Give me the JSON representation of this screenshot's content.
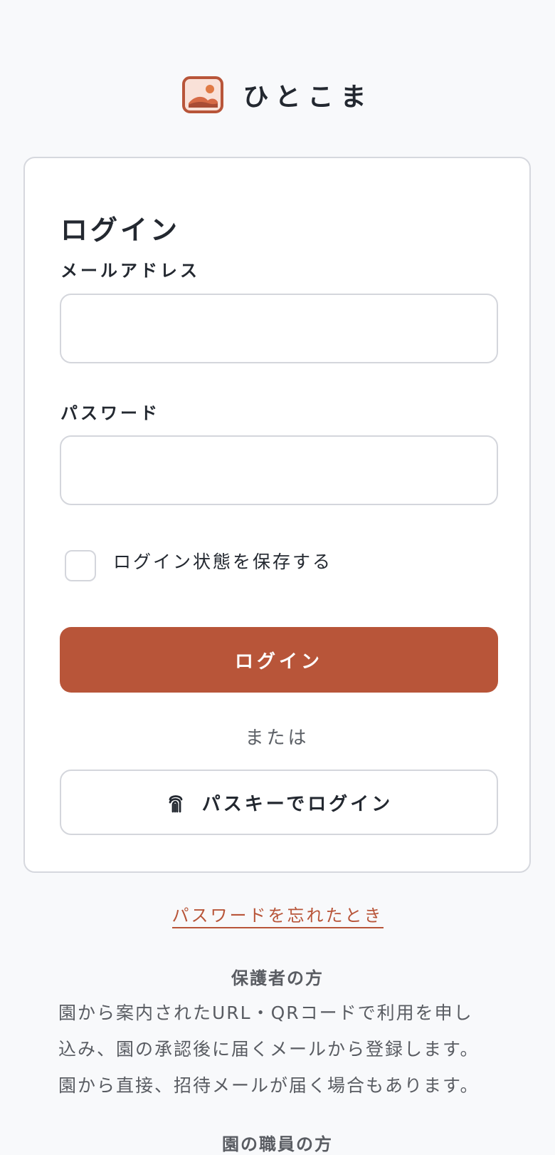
{
  "brand": {
    "name": "ひとこま",
    "icon": "photo-frame-logo",
    "color": "#b85539"
  },
  "login": {
    "title": "ログイン",
    "email_label": "メールアドレス",
    "email_value": "",
    "password_label": "パスワード",
    "password_value": "",
    "remember_label": "ログイン状態を保存する",
    "remember_checked": false,
    "submit_label": "ログイン",
    "divider_text": "または",
    "passkey_icon": "fingerprint-icon",
    "passkey_label": "パスキーでログイン"
  },
  "links": {
    "forgot_password": "パスワードを忘れたとき"
  },
  "guardian": {
    "title": "保護者の方",
    "text": "園から案内されたURL・QRコードで利用を申し\n込み、園の承認後に届くメールから登録します。\n園から直接、招待メールが届く場合もあります。"
  },
  "staff": {
    "title": "園の職員の方"
  },
  "colors": {
    "accent": "#b85539",
    "background": "#f8f9fb",
    "text": "#232830",
    "muted_text": "#595c62",
    "border": "#d4d6dc"
  }
}
